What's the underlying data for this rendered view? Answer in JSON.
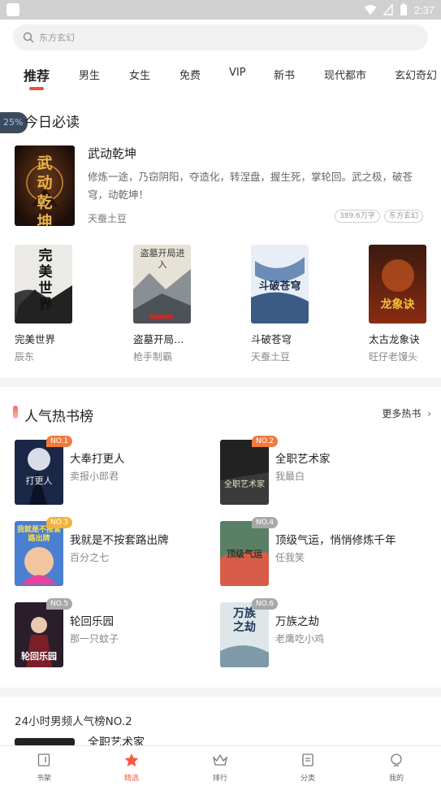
{
  "status_bar": {
    "time": "2:37"
  },
  "search": {
    "placeholder": "东方玄幻"
  },
  "tabs": [
    {
      "label": "推荐"
    },
    {
      "label": "男生"
    },
    {
      "label": "女生"
    },
    {
      "label": "免费"
    },
    {
      "label": "VIP"
    },
    {
      "label": "新书"
    },
    {
      "label": "现代都市"
    },
    {
      "label": "玄幻奇幻"
    }
  ],
  "floating_badge": "25%",
  "today": {
    "title": "今日必读",
    "featured": {
      "title": "武动乾坤",
      "cover_text": "武动乾坤",
      "desc": "修炼一途，乃窃阴阳，夺造化，转涅盘，握生死，掌轮回。武之极，破苍穹，动乾坤！",
      "author": "天蚕土豆",
      "words": "389.6万字",
      "genre": "东方玄幻"
    },
    "grid": [
      {
        "title": "完美世界",
        "author": "辰东",
        "cover_text": "完美世界"
      },
      {
        "title": "盗墓开局…",
        "author": "枪手制霸",
        "cover_text": "盗墓开局进入"
      },
      {
        "title": "斗破苍穹",
        "author": "天蚕土豆",
        "cover_text": "斗破苍穹"
      },
      {
        "title": "太古龙象诀",
        "author": "旺仔老馒头",
        "cover_text": "龙象诀"
      }
    ]
  },
  "hot": {
    "title": "人气热书榜",
    "more": "更多热书",
    "items": [
      {
        "rank": "NO.1",
        "title": "大奉打更人",
        "author": "卖报小郎君",
        "cover_text": "打更人"
      },
      {
        "rank": "NO.2",
        "title": "全职艺术家",
        "author": "我最白",
        "cover_text": "全职艺术家"
      },
      {
        "rank": "NO.3",
        "title": "我就是不按套路出牌",
        "author": "百分之七",
        "cover_text": "我就是不按套路出牌"
      },
      {
        "rank": "NO.4",
        "title": "顶级气运，悄悄修炼千年",
        "author": "任我笑",
        "cover_text": "顶级气运"
      },
      {
        "rank": "NO.5",
        "title": "轮回乐园",
        "author": "那一只蚊子",
        "cover_text": "轮回乐园"
      },
      {
        "rank": "NO.6",
        "title": "万族之劫",
        "author": "老鹰吃小鸡",
        "cover_text": "万族之劫"
      }
    ]
  },
  "list24": {
    "title": "24小时男频人气榜NO.2",
    "first_title": "全职艺术家"
  },
  "nav": [
    {
      "label": "书架",
      "icon": "book-icon"
    },
    {
      "label": "精选",
      "icon": "star-icon"
    },
    {
      "label": "排行",
      "icon": "crown-icon"
    },
    {
      "label": "分类",
      "icon": "category-icon"
    },
    {
      "label": "我的",
      "icon": "profile-icon"
    }
  ],
  "colors": {
    "accent": "#f24d3b",
    "rank_top": "#f27a3c",
    "rank_other": "#a8a8a8"
  }
}
